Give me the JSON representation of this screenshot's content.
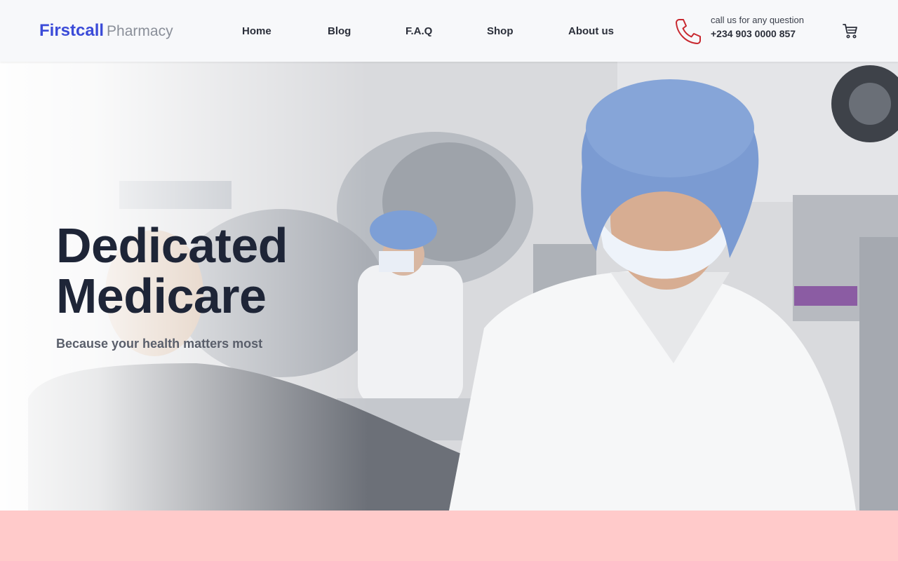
{
  "header": {
    "logo_brand": "Firstcall",
    "logo_sub": "Pharmacy",
    "nav": [
      "Home",
      "Blog",
      "F.A.Q",
      "Shop",
      "About us"
    ],
    "contact_prompt": "call us for any question",
    "contact_phone": "+234 903 0000 857"
  },
  "hero": {
    "title_line1": "Dedicated",
    "title_line2": "Medicare",
    "subtitle": "Because your health matters most"
  },
  "colors": {
    "brand": "#3b4bd8",
    "phone_icon": "#c8282f",
    "band": "#ffcaca",
    "title": "#1e2537"
  },
  "icons": {
    "phone": "phone-icon",
    "cart": "cart-icon"
  }
}
